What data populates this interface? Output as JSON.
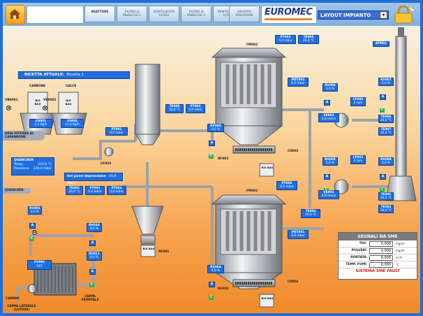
{
  "header": {
    "tabs": [
      {
        "label": "REATTORE",
        "active": true
      },
      {
        "label": "FILTRO A MANICHE 1",
        "active": false
      },
      {
        "label": "VENTILATORI CF001",
        "active": false
      },
      {
        "label": "FILTRO A MANICHE 2",
        "active": false
      },
      {
        "label": "VENTILATORI CF002",
        "active": false
      },
      {
        "label": "GRUPPO RIDUZIONI",
        "active": false
      }
    ],
    "logo": "EUROMEC",
    "layout_select": "LAYOUT IMPIANTO"
  },
  "recipe": {
    "label": "RICETTA ATTUALE:",
    "value": "Ricetta 1"
  },
  "silos": {
    "carbone": {
      "name": "CARBONE",
      "valve": "VB0001",
      "bag": "BIG BAG",
      "dosatore": "C0001",
      "value": "2,3 Kg/h"
    },
    "calce": {
      "name": "CALCE",
      "valve": "VB0002",
      "bag": "BIG BAG",
      "dosatore": "C0002",
      "value": "11,0 Kg/h"
    }
  },
  "aria_interna": "ARIA INTERNA AL CAPANNONE",
  "quencher_box": {
    "title": "QUENCHER",
    "temp_label": "Temp.",
    "temp_value": "220,0 °C",
    "pressure_label": "Pressione",
    "pressure_value": "220,0 mbar"
  },
  "setpoint": {
    "label": "Set point depressione",
    "value": "-20,0 mbar"
  },
  "quencher_pill": "QUENCHER",
  "fan_cf003": "CF003",
  "instruments": {
    "pt001_top": {
      "tag": "PT001",
      "value": "0,0 mbar"
    },
    "te008": {
      "tag": "TE008",
      "value": "20,0 °C"
    },
    "pt004": {
      "tag": "PT004",
      "value": "0,0 mbar"
    },
    "pt003_top": {
      "tag": "PT003",
      "value": "0,0 mbar"
    },
    "te005": {
      "tag": "TE005",
      "value": "20,0 °C"
    },
    "te003": {
      "tag": "TE003",
      "value": "20,0 °C"
    },
    "pt001_mid": {
      "tag": "PT001",
      "value": "0,0 mbar"
    },
    "pt002_mid": {
      "tag": "PT002",
      "value": "0,0 mbar"
    },
    "rv001": {
      "tag": "RV001",
      "value": "0,0 %"
    },
    "rv002": {
      "tag": "RV002",
      "value": "0,0 %"
    },
    "rv010": {
      "tag": "RV010",
      "value": "0,0 %"
    },
    "rv011": {
      "tag": "RV011",
      "value": "0,0 %"
    },
    "rv003": {
      "tag": "RV003",
      "value": "0,0 %"
    },
    "rv004": {
      "tag": "RV004",
      "value": "0,0 %"
    },
    "pdt002": {
      "tag": "PDT002",
      "value": "0,0 mbar"
    },
    "pdt001": {
      "tag": "PDT001",
      "value": "0,0 mbar"
    },
    "pt006": {
      "tag": "PT006",
      "value": "0,0 mbar"
    },
    "te004": {
      "tag": "TE004",
      "value": "20,0 °C"
    },
    "rv006": {
      "tag": "RV006",
      "value": "0,0 %"
    },
    "rv005": {
      "tag": "RV005",
      "value": "0,0 %"
    },
    "ve002": {
      "tag": "VE002",
      "value": "0,0 mm/s"
    },
    "ve001": {
      "tag": "VE001",
      "value": "0,0 mm/s"
    },
    "cf002": {
      "tag": "CF002",
      "value": "0 rpm"
    },
    "cf001": {
      "tag": "CF001",
      "value": "0 rpm"
    },
    "rv007": {
      "tag": "RV007",
      "value": "0,0 %"
    },
    "rv008": {
      "tag": "RV008",
      "value": "0,0 %"
    },
    "te006": {
      "tag": "TE006",
      "value": "20,0 °C"
    },
    "te007": {
      "tag": "TE007",
      "value": "20,0 °C"
    },
    "te001": {
      "tag": "TE001",
      "value": "20,0 °C"
    },
    "te002": {
      "tag": "TE002",
      "value": "20,0 °C"
    }
  },
  "filters": {
    "fm002": "FM002",
    "fm001": "FM001"
  },
  "rotary": {
    "rf002": "RF002",
    "rf003": "RF003",
    "rf001": "RF001",
    "c0003": "C0003",
    "c0004": "C0004"
  },
  "bags": {
    "big": "BIG BAG"
  },
  "fumo": {
    "title": "FUMO",
    "value": "OFF"
  },
  "camino": "CAMINO",
  "cappa_frontale": "CAPPA FRONTALE",
  "cappa_laterale": "CAPPA LATERALE (LOTUSS)",
  "atm": "ATM01",
  "h": "H",
  "sme": {
    "title": "SEGNALI DA SME",
    "rows": [
      {
        "name": "THC",
        "value": "0,000",
        "unit": "mg/m³"
      },
      {
        "name": "POLVERI",
        "value": "0,000",
        "unit": "mg/m³"
      },
      {
        "name": "PORTATA",
        "value": "0,000",
        "unit": "m³/h"
      },
      {
        "name": "TEMP. FUMI",
        "value": "0,000",
        "unit": "°C"
      }
    ],
    "fault": "SISTEMA SME FAULT"
  },
  "colors": {
    "accent": "#1f6fe0",
    "frame": "#1f6fd6",
    "ok": "#25b34a",
    "fault": "#d31313"
  }
}
